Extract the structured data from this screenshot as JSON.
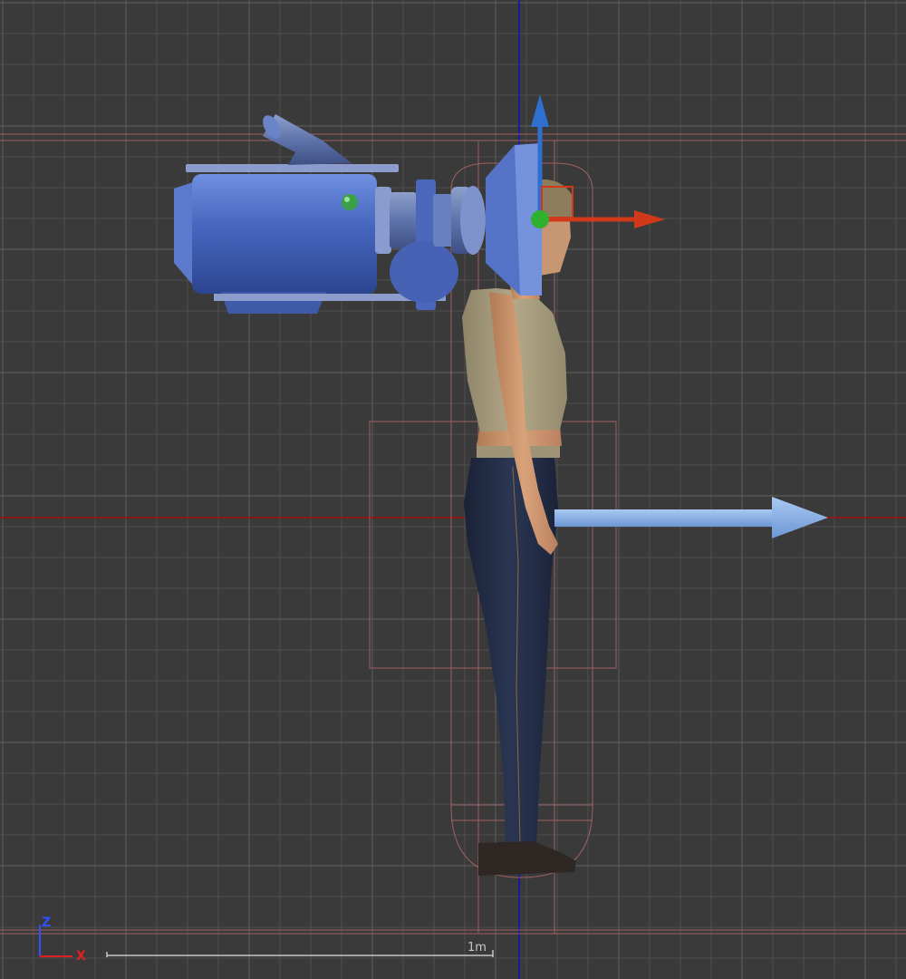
{
  "viewport": {
    "view": "side-orthographic",
    "background_color": "#3a3a3a",
    "grid_color": "#555555",
    "vertical_axis_color": "#1a1aa0",
    "horizontal_axis_color": "#8a1a1a",
    "bounds_color": "#a06060"
  },
  "axis_indicator": {
    "z_label": "Z",
    "x_label": "X",
    "z_color": "#3050ff",
    "x_color": "#e02020"
  },
  "scale_bar": {
    "label": "1m"
  },
  "objects": {
    "camera": {
      "icon": "video-camera-prop",
      "color": "#4a6cb8"
    },
    "figure": {
      "icon": "standing-woman-figure"
    },
    "gizmo": {
      "icon": "transform-gizmo",
      "up_color": "#2f6fd0",
      "forward_color": "#d03a1a",
      "pivot_color": "#30b030"
    },
    "direction_arrow": {
      "icon": "facing-direction-arrow",
      "color": "#8fb6e8"
    }
  }
}
